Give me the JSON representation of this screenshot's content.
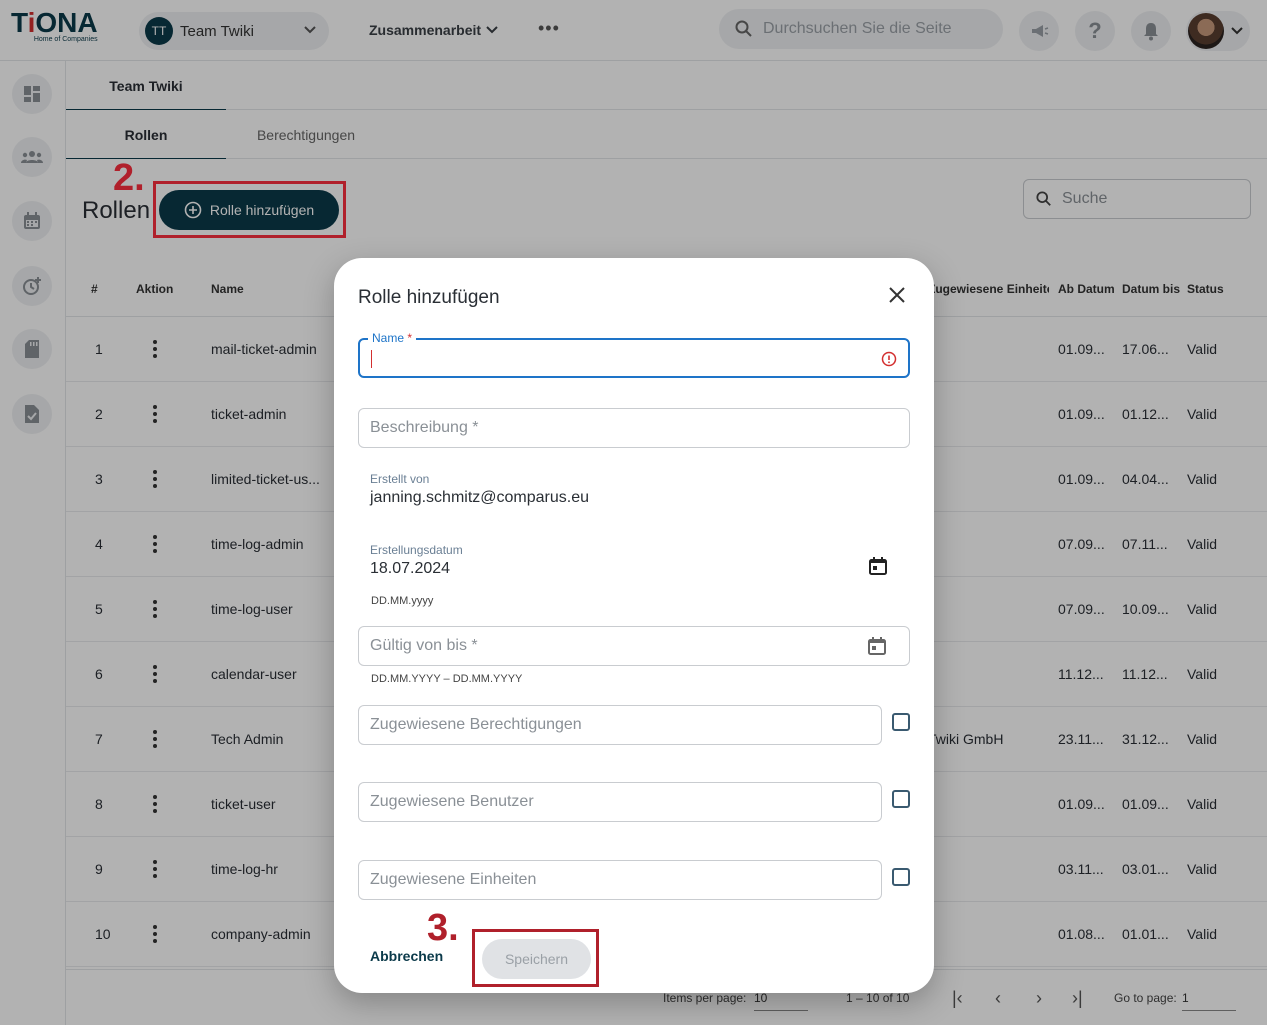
{
  "header": {
    "logo_text_left": "T",
    "logo_text_i": "i",
    "logo_text_right": "ONA",
    "logo_tagline": "Home of Companies",
    "team_initials": "TT",
    "team_name": "Team Twiki",
    "nav_collab": "Zusammenarbeit",
    "search_placeholder": "Durchsuchen Sie die Seite"
  },
  "tabs_primary": [
    {
      "label": "Team Twiki",
      "active": true
    }
  ],
  "tabs_secondary": [
    {
      "label": "Rollen",
      "active": true
    },
    {
      "label": "Berechtigungen",
      "active": false
    }
  ],
  "page": {
    "title": "Rollen",
    "add_button": "Rolle hinzufügen",
    "search_placeholder": "Suche",
    "step2": "2.",
    "step3": "3."
  },
  "table": {
    "columns": {
      "idx": "#",
      "action": "Aktion",
      "name": "Name",
      "units": "Zugewiesene Einheiten",
      "from": "Ab Datum",
      "to": "Datum bis",
      "status": "Status"
    },
    "rows": [
      {
        "idx": "1",
        "name": "mail-ticket-admin",
        "units": "",
        "from": "01.09...",
        "to": "17.06...",
        "status": "Valid"
      },
      {
        "idx": "2",
        "name": "ticket-admin",
        "units": "",
        "from": "01.09...",
        "to": "01.12...",
        "status": "Valid"
      },
      {
        "idx": "3",
        "name": "limited-ticket-us...",
        "units": "",
        "from": "01.09...",
        "to": "04.04...",
        "status": "Valid"
      },
      {
        "idx": "4",
        "name": "time-log-admin",
        "units": "",
        "from": "07.09...",
        "to": "07.11...",
        "status": "Valid"
      },
      {
        "idx": "5",
        "name": "time-log-user",
        "units": "",
        "from": "07.09...",
        "to": "10.09...",
        "status": "Valid"
      },
      {
        "idx": "6",
        "name": "calendar-user",
        "units": "",
        "from": "11.12...",
        "to": "11.12...",
        "status": "Valid"
      },
      {
        "idx": "7",
        "name": "Tech Admin",
        "units": "Twiki GmbH",
        "from": "23.11...",
        "to": "31.12...",
        "status": "Valid"
      },
      {
        "idx": "8",
        "name": "ticket-user",
        "units": "",
        "from": "01.09...",
        "to": "01.09...",
        "status": "Valid"
      },
      {
        "idx": "9",
        "name": "time-log-hr",
        "units": "",
        "from": "03.11...",
        "to": "03.01...",
        "status": "Valid"
      },
      {
        "idx": "10",
        "name": "company-admin",
        "units": "",
        "from": "01.08...",
        "to": "01.01...",
        "status": "Valid"
      }
    ]
  },
  "footer": {
    "items_per_page_label": "Items per page:",
    "items_per_page_value": "10",
    "range": "1 – 10 of 10",
    "go_to_page_label": "Go to page:",
    "go_to_page_value": "1"
  },
  "modal": {
    "title": "Rolle hinzufügen",
    "name_label": "Name",
    "name_required_mark": "*",
    "description_placeholder": "Beschreibung *",
    "created_by_label": "Erstellt von",
    "created_by_value": "janning.schmitz@comparus.eu",
    "created_date_label": "Erstellungsdatum",
    "created_date_value": "18.07.2024",
    "created_date_hint": "DD.MM.yyyy",
    "valid_range_placeholder": "Gültig von bis *",
    "valid_range_hint": "DD.MM.YYYY – DD.MM.YYYY",
    "assigned_permissions_placeholder": "Zugewiesene Berechtigungen",
    "assigned_users_placeholder": "Zugewiesene Benutzer",
    "assigned_units_placeholder": "Zugewiesene Einheiten",
    "cancel": "Abbrechen",
    "save": "Speichern"
  },
  "colors": {
    "primary": "#0b3a4a",
    "highlight": "#b0202b",
    "focus": "#1e74c8",
    "error": "#d32f2f"
  }
}
